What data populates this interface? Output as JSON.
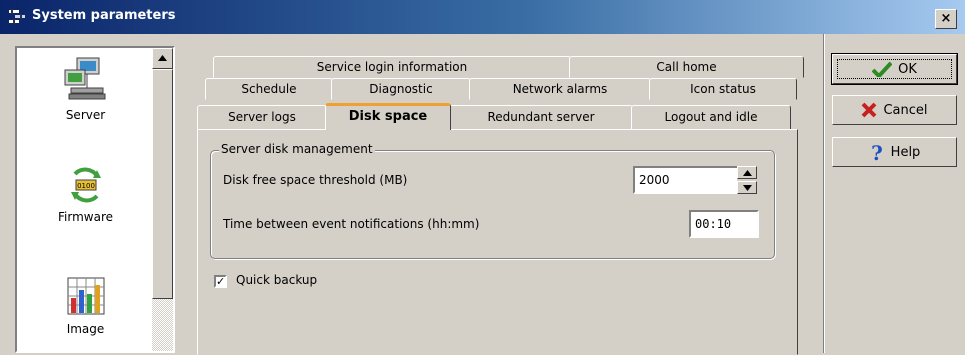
{
  "window": {
    "title": "System parameters",
    "close_glyph": "×"
  },
  "nav": {
    "items": [
      {
        "label": "Server",
        "icon": "server-icon",
        "selected": true
      },
      {
        "label": "Firmware",
        "icon": "firmware-icon",
        "selected": false
      },
      {
        "label": "Image",
        "icon": "image-chart-icon",
        "selected": false
      }
    ],
    "scroll_up_glyph": "▲"
  },
  "tabs": {
    "row1": [
      "Service login information",
      "Call home"
    ],
    "row2": [
      "Schedule",
      "Diagnostic",
      "Network alarms",
      "Icon status"
    ],
    "row3": [
      "Server logs",
      "Disk space",
      "Redundant server",
      "Logout and idle"
    ],
    "active": "Disk space"
  },
  "disk_space": {
    "group_title": "Server disk management",
    "threshold_label": "Disk free space threshold (MB)",
    "threshold_value": "2000",
    "notification_label": "Time between event notifications (hh:mm)",
    "notification_value": "00:10",
    "quick_backup_label": "Quick backup",
    "quick_backup_checked": true
  },
  "buttons": {
    "ok_label": "OK",
    "cancel_label": "Cancel",
    "help_label": "Help"
  },
  "colors": {
    "title_start": "#0a246a",
    "title_end": "#a6caf0",
    "active_tab_accent": "#f0a030"
  }
}
